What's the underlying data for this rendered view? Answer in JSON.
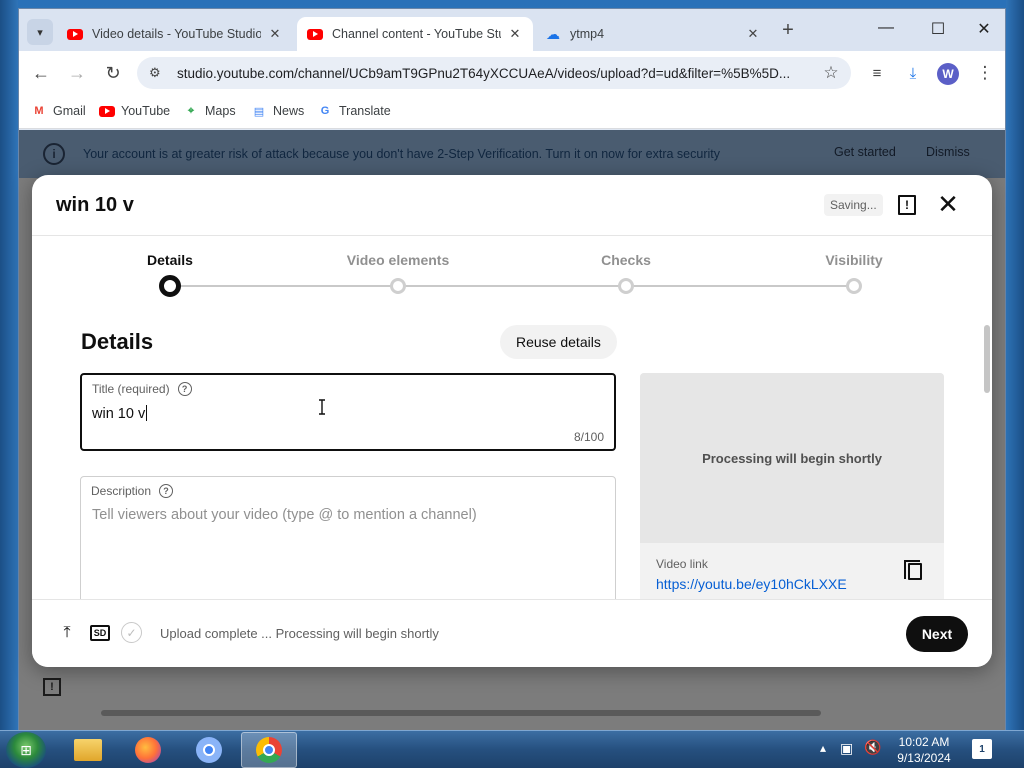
{
  "browser": {
    "tabs": [
      {
        "label": "Video details - YouTube Studio",
        "active": false
      },
      {
        "label": "Channel content - YouTube Studio",
        "active": true
      },
      {
        "label": "ytmp4",
        "active": false
      }
    ],
    "url": "studio.youtube.com/channel/UCb9amT9GPnu2T64yXCCUAeA/videos/upload?d=ud&filter=%5B%5D...",
    "profile_initial": "W",
    "bookmarks": [
      "Gmail",
      "YouTube",
      "Maps",
      "News",
      "Translate"
    ]
  },
  "warning": {
    "text": "Your account is at greater risk of attack because you don't have 2-Step Verification. Turn it on now for extra security",
    "get_started": "Get started",
    "dismiss": "Dismiss"
  },
  "modal": {
    "title": "win 10 v",
    "saving": "Saving...",
    "steps": [
      {
        "label": "Details",
        "active": true
      },
      {
        "label": "Video elements",
        "active": false
      },
      {
        "label": "Checks",
        "active": false
      },
      {
        "label": "Visibility",
        "active": false
      }
    ],
    "section_title": "Details",
    "reuse_label": "Reuse details",
    "title_field": {
      "label": "Title (required)",
      "value": "win 10 v",
      "count": "8/100"
    },
    "description_field": {
      "label": "Description",
      "placeholder": "Tell viewers about your video (type @ to mention a channel)"
    },
    "preview": {
      "processing": "Processing will begin shortly",
      "link_label": "Video link",
      "link_url": "https://youtu.be/ey10hCkLXXE"
    },
    "footer": {
      "status": "Upload complete ... Processing will begin shortly",
      "sd_label": "SD",
      "next": "Next"
    }
  },
  "taskbar": {
    "time": "10:02 AM",
    "date": "9/13/2024",
    "notification_count": "1"
  }
}
